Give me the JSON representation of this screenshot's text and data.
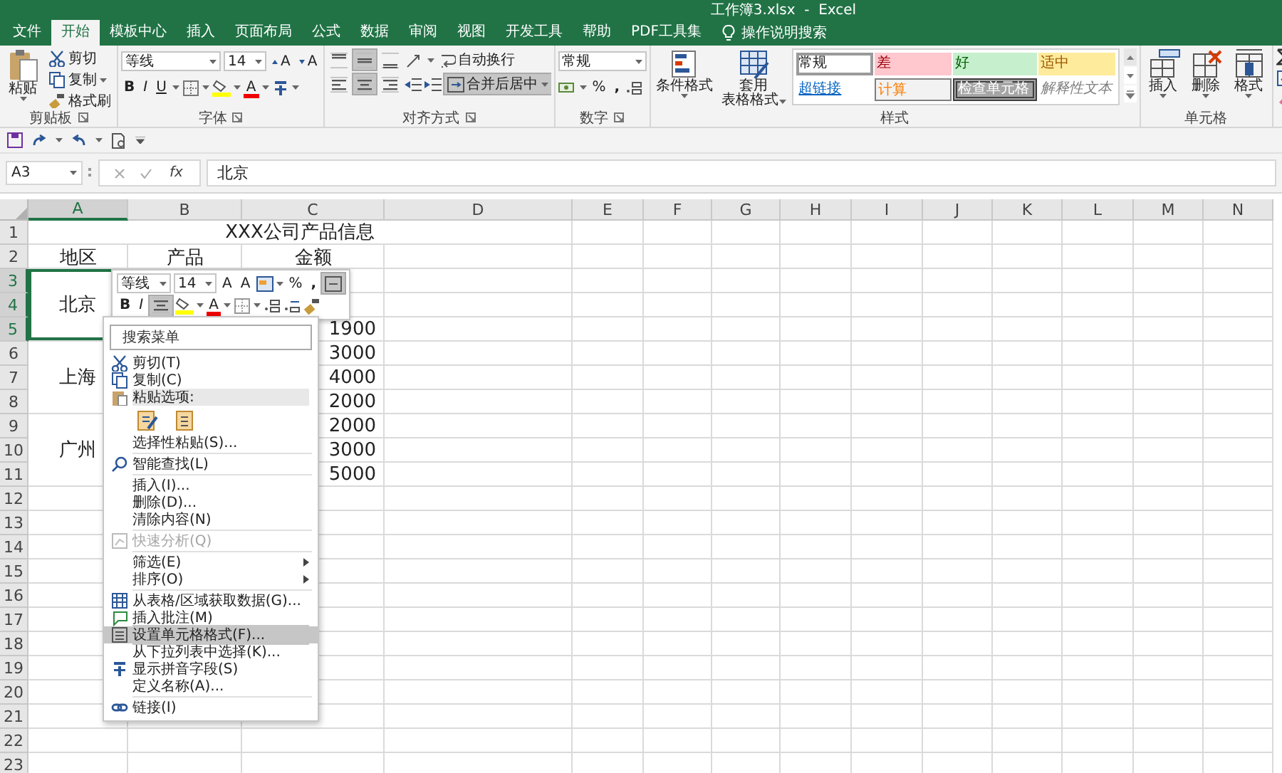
{
  "window": {
    "title": "工作簿3.xlsx  -  Excel"
  },
  "tabs": [
    {
      "label": "文件",
      "selected": false
    },
    {
      "label": "开始",
      "selected": true
    },
    {
      "label": "模板中心",
      "selected": false
    },
    {
      "label": "插入",
      "selected": false
    },
    {
      "label": "页面布局",
      "selected": false
    },
    {
      "label": "公式",
      "selected": false
    },
    {
      "label": "数据",
      "selected": false
    },
    {
      "label": "审阅",
      "selected": false
    },
    {
      "label": "视图",
      "selected": false
    },
    {
      "label": "开发工具",
      "selected": false
    },
    {
      "label": "帮助",
      "selected": false
    },
    {
      "label": "PDF工具集",
      "selected": false
    }
  ],
  "tell_me": {
    "placeholder": "操作说明搜索"
  },
  "ribbon": {
    "clipboard": {
      "label": "剪贴板",
      "paste": "粘贴",
      "cut": "剪切",
      "copy": "复制",
      "format_painter": "格式刷"
    },
    "font": {
      "label": "字体",
      "name": "等线",
      "size": "14",
      "grow": "A",
      "shrink": "A",
      "styles": [
        {
          "text": "B",
          "kind": "bold"
        },
        {
          "text": "I",
          "kind": "italic"
        },
        {
          "text": "U",
          "kind": "underline"
        }
      ],
      "color_button": "A"
    },
    "alignment": {
      "label": "对齐方式",
      "vertical": [
        {
          "selected": false
        },
        {
          "selected": true
        },
        {
          "selected": false
        }
      ],
      "horizontal": [
        {
          "selected": false
        },
        {
          "selected": true
        },
        {
          "selected": false
        }
      ],
      "wrap": {
        "label": "自动换行",
        "selected": false
      },
      "merge": {
        "label": "合并后居中",
        "selected": true
      }
    },
    "number": {
      "label": "数字",
      "format": "常规",
      "percent": "%",
      "comma": ","
    },
    "styles": {
      "label": "样式",
      "conditional": "条件格式",
      "table": [
        "套用",
        "表格格式"
      ],
      "gallery": [
        {
          "label": "常规",
          "kind": "normal",
          "selected": true
        },
        {
          "label": "差",
          "kind": "bad",
          "selected": false
        },
        {
          "label": "好",
          "kind": "good",
          "selected": false
        },
        {
          "label": "适中",
          "kind": "neutral",
          "selected": false
        },
        {
          "label": "超链接",
          "kind": "hyperlink",
          "selected": false
        },
        {
          "label": "计算",
          "kind": "calculation",
          "selected": false
        },
        {
          "label": "检查单元格",
          "kind": "check",
          "selected": false
        },
        {
          "label": "解释性文本",
          "kind": "explanatory",
          "selected": false
        }
      ]
    },
    "cells": {
      "label": "单元格",
      "buttons": [
        {
          "label": "插入",
          "kind": "insert"
        },
        {
          "label": "删除",
          "kind": "delete"
        },
        {
          "label": "格式",
          "kind": "format"
        }
      ]
    }
  },
  "formula_bar": {
    "name_box": "A3",
    "fx": "fx",
    "value": "北京"
  },
  "sheet": {
    "columns": [
      {
        "label": "A",
        "selected": true
      },
      {
        "label": "B",
        "selected": false
      },
      {
        "label": "C",
        "selected": false
      },
      {
        "label": "D",
        "selected": false
      },
      {
        "label": "E",
        "selected": false
      },
      {
        "label": "F",
        "selected": false
      },
      {
        "label": "G",
        "selected": false
      },
      {
        "label": "H",
        "selected": false
      },
      {
        "label": "I",
        "selected": false
      },
      {
        "label": "J",
        "selected": false
      },
      {
        "label": "K",
        "selected": false
      },
      {
        "label": "L",
        "selected": false
      },
      {
        "label": "M",
        "selected": false
      },
      {
        "label": "N",
        "selected": false
      }
    ],
    "rows": [
      {
        "label": "1",
        "selected": false
      },
      {
        "label": "2",
        "selected": false
      },
      {
        "label": "3",
        "selected": true
      },
      {
        "label": "4",
        "selected": true
      },
      {
        "label": "5",
        "selected": true
      },
      {
        "label": "6",
        "selected": false
      },
      {
        "label": "7",
        "selected": false
      },
      {
        "label": "8",
        "selected": false
      },
      {
        "label": "9",
        "selected": false
      },
      {
        "label": "10",
        "selected": false
      },
      {
        "label": "11",
        "selected": false
      },
      {
        "label": "12",
        "selected": false
      },
      {
        "label": "13",
        "selected": false
      },
      {
        "label": "14",
        "selected": false
      },
      {
        "label": "15",
        "selected": false
      },
      {
        "label": "16",
        "selected": false
      },
      {
        "label": "17",
        "selected": false
      },
      {
        "label": "18",
        "selected": false
      },
      {
        "label": "19",
        "selected": false
      },
      {
        "label": "20",
        "selected": false
      },
      {
        "label": "21",
        "selected": false
      },
      {
        "label": "22",
        "selected": false
      },
      {
        "label": "23",
        "selected": false
      }
    ],
    "title": "XXX公司产品信息",
    "headers": [
      "地区",
      "产品",
      "金额"
    ],
    "regions": [
      "北京",
      "上海",
      "广州"
    ],
    "amounts": [
      "1900",
      "3000",
      "4000",
      "2000",
      "2000",
      "3000",
      "5000"
    ]
  },
  "mini_toolbar": {
    "font": "等线",
    "size": "14",
    "grow": "A",
    "shrink": "A",
    "percent": "%",
    "comma": ",",
    "bold": "B",
    "italic": "I",
    "color_button": "A",
    "center_selected": true,
    "merge_selected": true
  },
  "context_menu": {
    "search": {
      "placeholder": "搜索菜单"
    },
    "groups": [
      [
        {
          "kind": "cut",
          "label": "剪切(T)",
          "disabled": false,
          "selected": false,
          "submenu": false
        },
        {
          "kind": "copy",
          "label": "复制(C)",
          "disabled": false,
          "selected": false,
          "submenu": false
        },
        {
          "kind": "paste_header",
          "label": "粘贴选项:",
          "disabled": false,
          "selected": false,
          "submenu": false
        },
        {
          "kind": "paste_options",
          "disabled": false,
          "selected": false,
          "submenu": false
        },
        {
          "kind": "plain",
          "label": "选择性粘贴(S)...",
          "disabled": false,
          "selected": false,
          "submenu": false
        }
      ],
      [
        {
          "kind": "lookup",
          "label": "智能查找(L)",
          "disabled": false,
          "selected": false,
          "submenu": false
        }
      ],
      [
        {
          "kind": "plain",
          "label": "插入(I)...",
          "disabled": false,
          "selected": false,
          "submenu": false
        },
        {
          "kind": "plain",
          "label": "删除(D)...",
          "disabled": false,
          "selected": false,
          "submenu": false
        },
        {
          "kind": "plain",
          "label": "清除内容(N)",
          "disabled": false,
          "selected": false,
          "submenu": false
        }
      ],
      [
        {
          "kind": "analysis",
          "label": "快速分析(Q)",
          "disabled": true,
          "selected": false,
          "submenu": false
        }
      ],
      [
        {
          "kind": "plain",
          "label": "筛选(E)",
          "disabled": false,
          "selected": false,
          "submenu": true
        },
        {
          "kind": "plain",
          "label": "排序(O)",
          "disabled": false,
          "selected": false,
          "submenu": true
        }
      ],
      [
        {
          "kind": "table",
          "label": "从表格/区域获取数据(G)...",
          "disabled": false,
          "selected": false,
          "submenu": false
        },
        {
          "kind": "comment",
          "label": "插入批注(M)",
          "disabled": false,
          "selected": false,
          "submenu": false
        },
        {
          "kind": "format",
          "label": "设置单元格格式(F)...",
          "disabled": false,
          "selected": true,
          "submenu": false
        },
        {
          "kind": "plain",
          "label": "从下拉列表中选择(K)...",
          "disabled": false,
          "selected": false,
          "submenu": false
        },
        {
          "kind": "pinyin",
          "label": "显示拼音字段(S)",
          "disabled": false,
          "selected": false,
          "submenu": false
        },
        {
          "kind": "plain",
          "label": "定义名称(A)...",
          "disabled": false,
          "selected": false,
          "submenu": false
        }
      ],
      [
        {
          "kind": "link",
          "label": "链接(I)",
          "disabled": false,
          "selected": false,
          "submenu": false
        }
      ]
    ]
  }
}
